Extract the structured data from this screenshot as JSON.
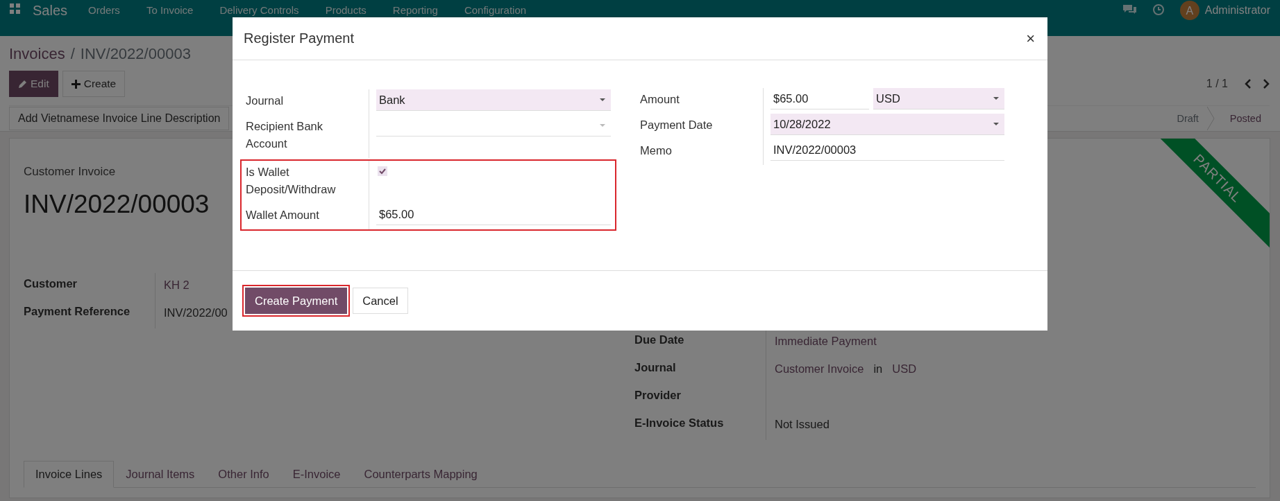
{
  "navbar": {
    "app": "Sales",
    "menu": [
      "Orders",
      "To Invoice",
      "Delivery Controls",
      "Products",
      "Reporting",
      "Configuration"
    ],
    "avatar": "A",
    "user": "Administrator"
  },
  "control_panel": {
    "breadcrumb": [
      {
        "label": "Invoices",
        "current": false
      },
      {
        "label": "INV/2022/00003",
        "current": true
      }
    ],
    "separator": "/",
    "buttons": [
      {
        "label": "Edit",
        "primary": true
      },
      {
        "label": "Create",
        "primary": false
      }
    ],
    "pager": "1 / 1",
    "action": "Add Vietnamese Invoice Line Description",
    "statuses": [
      {
        "label": "Draft",
        "selected": false
      },
      {
        "label": "Posted",
        "selected": true
      }
    ]
  },
  "sheet": {
    "ribbon": "PARTIAL",
    "subtitle": "Customer Invoice",
    "title": "INV/2022/00003",
    "left_fields": [
      {
        "label": "Customer",
        "value": "KH 2",
        "link": true
      },
      {
        "label": "Payment Reference",
        "value": "INV/2022/00",
        "link": false
      }
    ],
    "right_fields": [
      {
        "label": "Due Date",
        "parts": [
          {
            "text": "Immediate Payment",
            "link": true
          }
        ]
      },
      {
        "label": "Journal",
        "parts": [
          {
            "text": "Customer Invoice",
            "link": true
          },
          {
            "text": "in",
            "link": false
          },
          {
            "text": "USD",
            "link": true
          }
        ]
      },
      {
        "label": "Provider"
      },
      {
        "label": "E-Invoice Status",
        "parts": [
          {
            "text": "Not Issued",
            "link": false
          }
        ]
      }
    ],
    "tabs": [
      {
        "label": "Invoice Lines",
        "selected": true
      },
      {
        "label": "Journal Items",
        "selected": false
      },
      {
        "label": "Other Info",
        "selected": false
      },
      {
        "label": "E-Invoice",
        "selected": false
      },
      {
        "label": "Counterparts Mapping",
        "selected": false
      }
    ]
  },
  "dialog": {
    "title": "Register Payment",
    "close": "×",
    "left_groups": [
      {
        "highlighted": false,
        "fields": [
          {
            "kind": "select",
            "label": "Journal",
            "value": "Bank",
            "required": true
          },
          {
            "kind": "select",
            "label": "Recipient Bank Account",
            "required": false
          }
        ]
      },
      {
        "highlighted": true,
        "fields": [
          {
            "kind": "checkbox",
            "label": "Is Wallet Deposit/Withdraw",
            "checked": true
          },
          {
            "kind": "text",
            "label": "Wallet Amount",
            "value": "$65.00",
            "required": false
          }
        ]
      }
    ],
    "right_fields": [
      {
        "kind": "amount",
        "label": "Amount",
        "value": "$65.00",
        "currency": "USD",
        "required": false
      },
      {
        "kind": "select",
        "label": "Payment Date",
        "value": "10/28/2022",
        "required": true
      },
      {
        "kind": "text",
        "label": "Memo",
        "value": "INV/2022/00003",
        "required": false
      }
    ],
    "buttons": [
      {
        "label": "Create Payment",
        "primary": true,
        "highlighted": true
      },
      {
        "label": "Cancel",
        "primary": false,
        "highlighted": false
      }
    ]
  }
}
